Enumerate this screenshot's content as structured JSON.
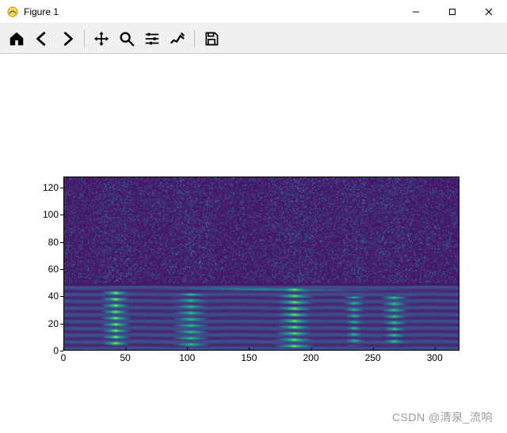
{
  "window": {
    "title": "Figure 1",
    "buttons": {
      "minimize": "–",
      "maximize": "□",
      "close": "×"
    }
  },
  "toolbar": {
    "home": "Home",
    "back": "Back",
    "forward": "Forward",
    "pan": "Pan",
    "zoom": "Zoom",
    "subplots": "Configure subplots",
    "edit": "Edit axis",
    "save": "Save"
  },
  "watermark": "CSDN @清泉_流响",
  "chart_data": {
    "type": "heatmap",
    "title": "",
    "xlabel": "",
    "ylabel": "",
    "xlim": [
      0,
      320
    ],
    "ylim": [
      0,
      128
    ],
    "x_ticks": [
      0,
      50,
      100,
      150,
      200,
      250,
      300
    ],
    "y_ticks": [
      0,
      20,
      40,
      60,
      80,
      100,
      120
    ],
    "colormap": "viridis",
    "colormap_stops": [
      [
        0.0,
        "#440154"
      ],
      [
        0.15,
        "#472d7b"
      ],
      [
        0.3,
        "#3b528b"
      ],
      [
        0.45,
        "#2c728e"
      ],
      [
        0.6,
        "#21918c"
      ],
      [
        0.72,
        "#28ae80"
      ],
      [
        0.82,
        "#5ec962"
      ],
      [
        0.92,
        "#addc30"
      ],
      [
        1.0,
        "#fde725"
      ]
    ],
    "description": "Mel-spectrogram style heatmap: 128 frequency bins (y) over ~320 time frames (x). Low-frequency bands (y ≈ 0–40) show strong horizontal striations with bright yellow-green energy bursts around x≈30–55, 85–120, 170–205, 225–245 and 255–280. A thin bright band persists near y≈45 across the full width. Above y≈50 values are mostly dark purple (low energy) with scattered teal/green speckle and some vertical brightening near the same x positions as the low-band bursts.",
    "bright_regions": [
      {
        "x0": 28,
        "x1": 55,
        "y0": 2,
        "y1": 45,
        "intensity": 0.95
      },
      {
        "x0": 85,
        "x1": 120,
        "y0": 2,
        "y1": 42,
        "intensity": 0.8
      },
      {
        "x0": 168,
        "x1": 205,
        "y0": 2,
        "y1": 48,
        "intensity": 0.92
      },
      {
        "x0": 225,
        "x1": 245,
        "y0": 3,
        "y1": 40,
        "intensity": 0.78
      },
      {
        "x0": 255,
        "x1": 280,
        "y0": 3,
        "y1": 40,
        "intensity": 0.82
      },
      {
        "x0": 0,
        "x1": 320,
        "y0": 44,
        "y1": 48,
        "intensity": 0.55
      }
    ],
    "upper_speckle": {
      "y0": 50,
      "y1": 128,
      "base_intensity": 0.08,
      "speckle_intensity": 0.35
    }
  }
}
